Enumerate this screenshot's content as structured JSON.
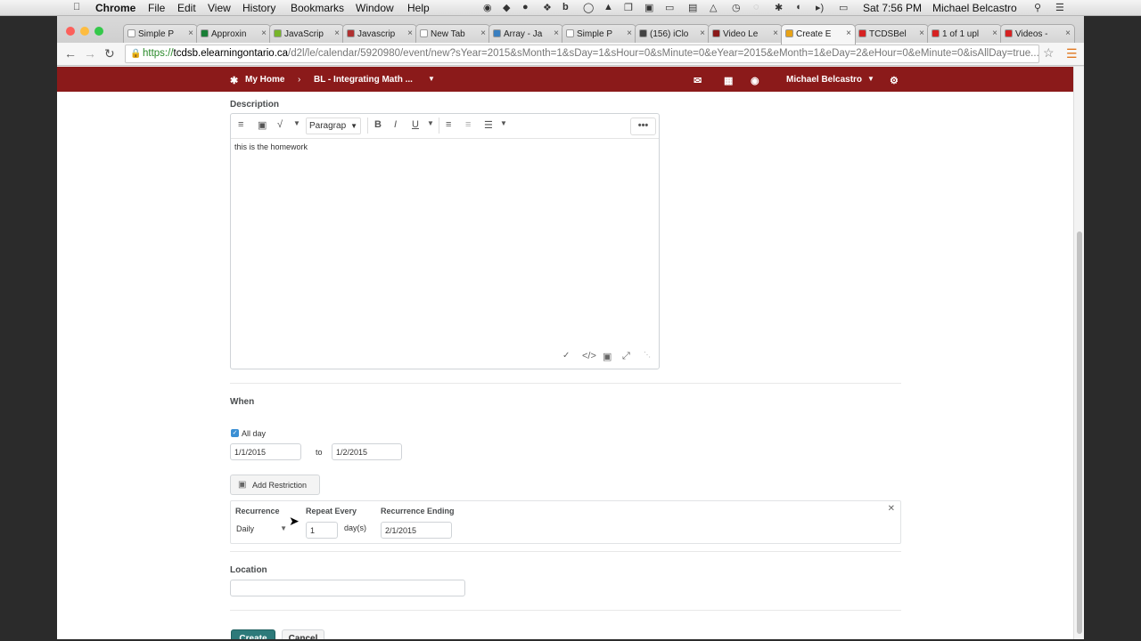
{
  "menubar": {
    "app_name": "Chrome",
    "menus": [
      "File",
      "Edit",
      "View",
      "History",
      "Bookmarks",
      "Window",
      "Help"
    ],
    "clock": "Sat 7:56 PM",
    "user": "Michael Belcastro"
  },
  "tabs": [
    {
      "label": "Simple P",
      "color": "#ffffff"
    },
    {
      "label": "Approxin",
      "color": "#1a7f37"
    },
    {
      "label": "JavaScrip",
      "color": "#77b52a"
    },
    {
      "label": "Javascrip",
      "color": "#b03030"
    },
    {
      "label": "New Tab",
      "color": "#ffffff"
    },
    {
      "label": "Array - Ja",
      "color": "#3a7fc0"
    },
    {
      "label": "Simple P",
      "color": "#ffffff"
    },
    {
      "label": "(156) iClo",
      "color": "#444444"
    },
    {
      "label": "Video Le",
      "color": "#8b1a1a"
    },
    {
      "label": "Create E",
      "color": "#e8a317"
    },
    {
      "label": "TCDSBel",
      "color": "#d62222"
    },
    {
      "label": "1 of 1 upl",
      "color": "#d62222"
    },
    {
      "label": "Videos -",
      "color": "#d62222"
    }
  ],
  "address": {
    "scheme": "https://",
    "host": "tcdsb.elearningontario.ca",
    "path": "/d2l/le/calendar/5920980/event/new?sYear=2015&sMonth=1&sDay=1&sHour=0&sMinute=0&eYear=2015&eMonth=1&eDay=2&eHour=0&eMinute=0&isAllDay=true..."
  },
  "nav": {
    "home": "My Home",
    "course": "BL - Integrating Math ...",
    "user": "Michael Belcastro"
  },
  "description": {
    "label": "Description",
    "format": "Paragrap",
    "bold": "B",
    "italic": "I",
    "underline": "U",
    "more": "•••",
    "body": "this is the homework"
  },
  "when": {
    "label": "When",
    "all_day": "All day",
    "start_date": "1/1/2015",
    "to": "to",
    "end_date": "1/2/2015"
  },
  "restriction": {
    "button": "Add Restriction"
  },
  "recurrence": {
    "recurrence_label": "Recurrence",
    "recurrence_value": "Daily",
    "repeat_label": "Repeat Every",
    "repeat_value": "1",
    "repeat_unit": "day(s)",
    "ending_label": "Recurrence Ending",
    "ending_value": "2/1/2015"
  },
  "location": {
    "label": "Location",
    "value": ""
  },
  "actions": {
    "create": "Create",
    "cancel": "Cancel"
  }
}
